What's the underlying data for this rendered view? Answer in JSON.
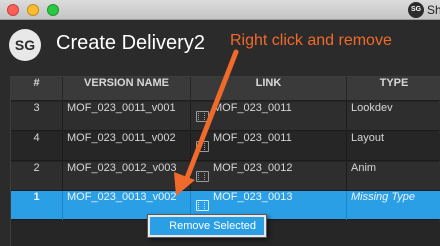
{
  "window": {
    "title_logo": "SG",
    "title": "Sh"
  },
  "header": {
    "logo_text": "SG",
    "title": "Create Delivery2",
    "annotation": "Right click and remove"
  },
  "table": {
    "columns": [
      "#",
      "VERSION NAME",
      "LINK",
      "TYPE"
    ],
    "rows": [
      {
        "num": "3",
        "version": "MOF_023_0011_v001",
        "link": "MOF_023_0011",
        "type": "Lookdev",
        "selected": false
      },
      {
        "num": "4",
        "version": "MOF_023_0011_v002",
        "link": "MOF_023_0011",
        "type": "Layout",
        "selected": false
      },
      {
        "num": "2",
        "version": "MOF_023_0012_v003",
        "link": "MOF_023_0012",
        "type": "Anim",
        "selected": false
      },
      {
        "num": "1",
        "version": "MOF_023_0013_v002",
        "link": "MOF_023_0013",
        "type": "Missing Type",
        "selected": true
      }
    ]
  },
  "context_menu": {
    "item": "Remove Selected"
  },
  "colors": {
    "annotation": "#f06a2c",
    "selection": "#2b9fe5",
    "background": "#2b2b2b"
  },
  "icons": {
    "link": "film-icon"
  }
}
